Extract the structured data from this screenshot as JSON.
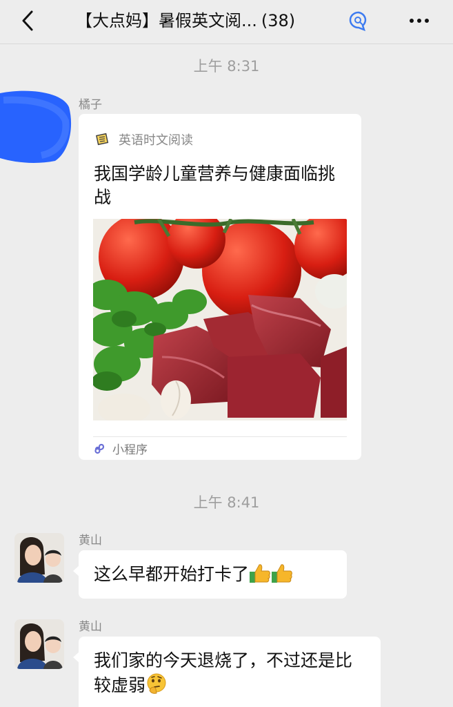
{
  "header": {
    "back_icon": "chevron-left-icon",
    "title": "【大点妈】暑假英文阅...",
    "member_count": "(38)",
    "search_icon": "chat-search-icon",
    "more_icon": "more-dots-icon"
  },
  "messages": [
    {
      "time": "上午 8:31",
      "sender": "橘子",
      "type": "mini-program",
      "card": {
        "source": "英语时文阅读",
        "title": "我国学龄儿童营养与健康面临挑战",
        "footer": "小程序"
      }
    },
    {
      "time": "上午 8:41",
      "sender": "黄山",
      "text": "这么早都开始打卡了",
      "emojis": [
        "thumbs-up-emoji",
        "thumbs-up-emoji"
      ]
    },
    {
      "sender": "黄山",
      "text": "我们家的今天退烧了，不过还是比较虚弱",
      "emojis": [
        "thinking-face-emoji"
      ]
    }
  ],
  "colors": {
    "background": "#ededed",
    "bubble": "#ffffff",
    "time_text": "#9e9e9e",
    "sender_text": "#888888",
    "redaction": "#1e5cff"
  }
}
